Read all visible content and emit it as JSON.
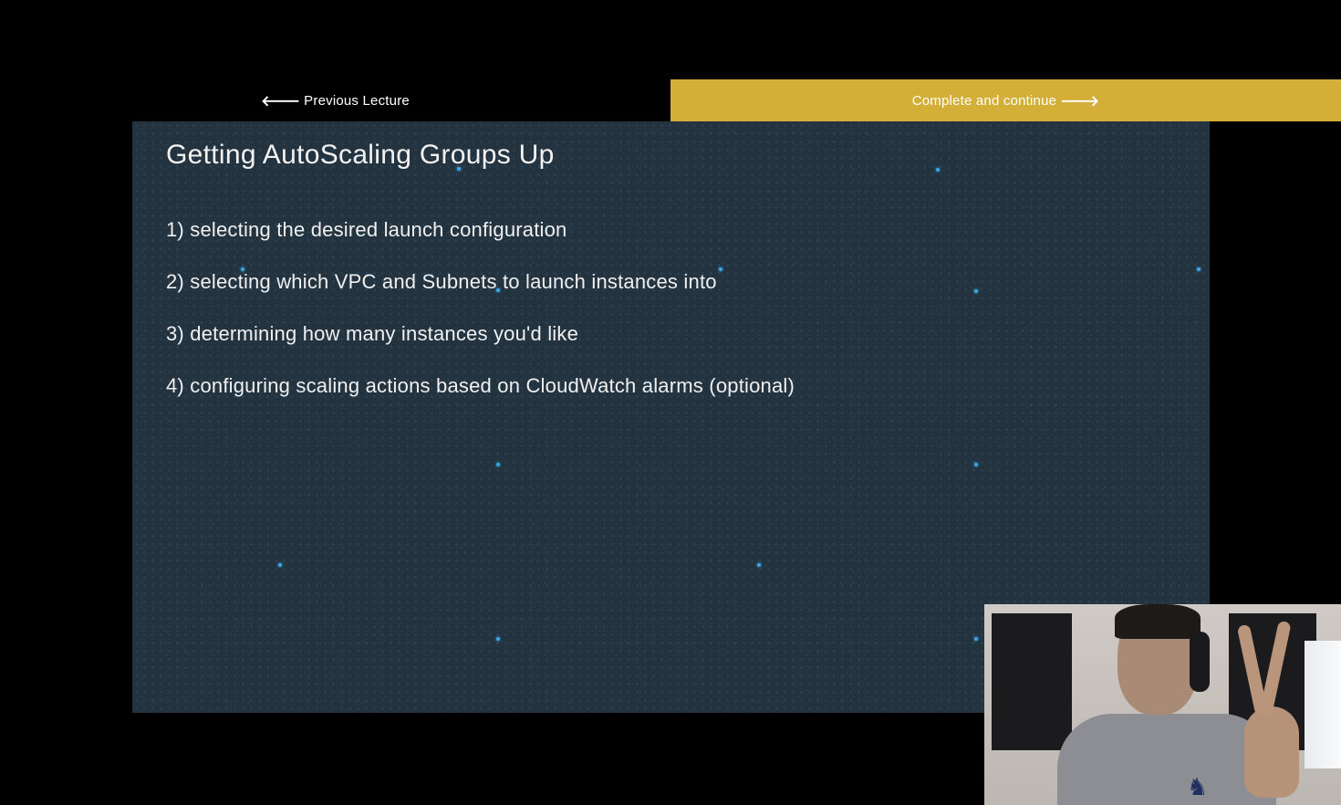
{
  "nav": {
    "previous_label": "Previous Lecture",
    "previous_icon": "arrow-left-icon",
    "next_label": "Complete and continue",
    "next_icon": "arrow-right-icon"
  },
  "slide": {
    "title": "Getting AutoScaling Groups Up",
    "items": [
      "1) selecting the desired launch configuration",
      "2) selecting which VPC and Subnets to launch instances into",
      "3) determining how many instances you'd like",
      "4) configuring scaling actions based on CloudWatch alarms (optional)"
    ]
  },
  "colors": {
    "background": "#000000",
    "accent": "#d4af37",
    "slide_background": "#233340",
    "star": "#3aa7e8"
  }
}
